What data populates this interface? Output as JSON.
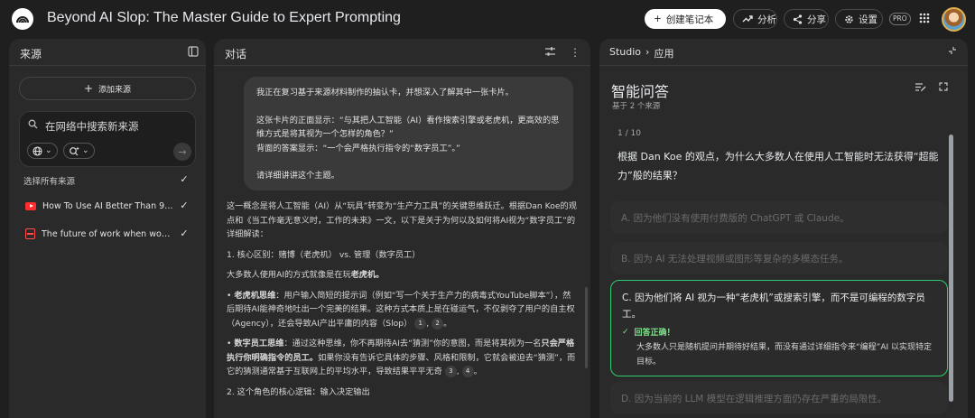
{
  "header": {
    "title": "Beyond AI Slop: The Master Guide to Expert Prompting",
    "create_notebook": "创建笔记本",
    "analytics": "分析",
    "share": "分享",
    "settings": "设置",
    "pro_badge": "PRO"
  },
  "sources": {
    "title": "来源",
    "add_source": "添加来源",
    "search_placeholder": "在网络中搜索新来源",
    "select_all": "选择所有来源",
    "items": [
      {
        "label": "How To Use AI Better Than 99% ...",
        "icon": "youtube-icon",
        "checked": true
      },
      {
        "label": "The future of work when work is ...",
        "icon": "document-icon",
        "checked": true
      }
    ]
  },
  "chat": {
    "title": "对话",
    "user_message": [
      "我正在复习基于来源材料制作的抽认卡，并想深入了解其中一张卡片。",
      "",
      "这张卡片的正面显示：“与其把人工智能（AI）看作搜索引擎或老虎机，更高效的思维方式是将其视为一个怎样的角色？”",
      "背面的答案显示：“一个会严格执行指令的“数字员工”。”",
      "",
      "请详细讲讲这个主题。"
    ],
    "answer": {
      "p1": "这一概念是将人工智能（AI）从“玩具”转变为“生产力工具”的关键思维跃迁。根据Dan Koe的观点和《当工作毫无意义时，工作的未来》一文，以下是关于为何以及如何将AI视为“数字员工”的详细解读：",
      "h1": "1. 核心区别：赌博（老虎机） vs. 管理（数字员工）",
      "p2_pre": "大多数人使用AI的方式就像是在玩",
      "p2_bold": "老虎机。",
      "b1_bold": "老虎机思维",
      "b1_text": "：用户输入简短的提示词（例如“写一个关于生产力的病毒式YouTube脚本”），然后期待AI能神奇地吐出一个完美的结果。这种方式本质上是在碰运气，不仅剥夺了用户的自主权（Agency），还会导致AI产出平庸的内容（Slop）",
      "b1_cites": [
        "1",
        "2"
      ],
      "b2_bold": "数字员工思维",
      "b2_text1": "：通过这种思维，你不再期待AI去“猜测”你的意图，而是将其视为一名",
      "b2_bold2": "只会严格执行你明确指令的员工。",
      "b2_text2": "如果你没有告诉它具体的步骤、风格和限制，它就会被迫去“猜测”，而它的猜测通常基于互联网上的平均水平，导致结果平平无奇",
      "b2_cites": [
        "3",
        "4"
      ],
      "h2": "2. 这个角色的核心逻辑：输入决定输出"
    }
  },
  "studio": {
    "crumb_root": "Studio",
    "crumb_current": "应用",
    "quiz_title": "智能问答",
    "quiz_sub": "基于 2 个来源",
    "counter": "1 / 10",
    "question": "根据 Dan Koe 的观点，为什么大多数人在使用人工智能时无法获得“超能力”般的结果？",
    "options": {
      "a": "A. 因为他们没有使用付费版的 ChatGPT 或 Claude。",
      "b": "B. 因为 AI 无法处理视频或图形等复杂的多模态任务。",
      "c": "C. 因为他们将 AI 视为一种“老虎机”或搜索引擎，而不是可编程的数字员工。",
      "d": "D. 因为当前的 LLM 模型在逻辑推理方面仍存在严重的局限性。"
    },
    "correct_label": "回答正确！",
    "explanation": "大多数人只是随机提问并期待好结果，而没有通过详细指令来“编程”AI 以实现特定目标。"
  },
  "colors": {
    "correct_border": "#2ecc71",
    "correct_text": "#7ee08a",
    "youtube_red": "#ff2d2d"
  }
}
